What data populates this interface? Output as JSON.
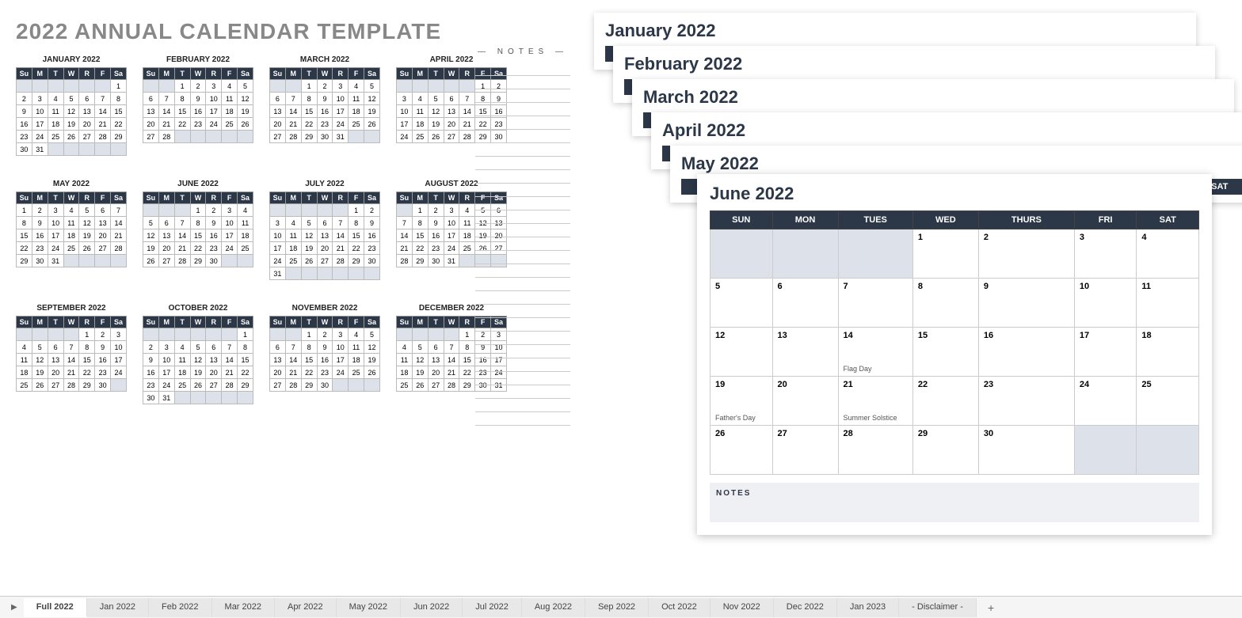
{
  "title": "2022 ANNUAL CALENDAR TEMPLATE",
  "days_short": [
    "Su",
    "M",
    "T",
    "W",
    "R",
    "F",
    "Sa"
  ],
  "days_long": [
    "SUN",
    "MON",
    "TUES",
    "WED",
    "THURS",
    "FRI",
    "SAT"
  ],
  "notes_label": "NOTES",
  "minical_months": [
    {
      "name": "JANUARY 2022",
      "start": 6,
      "days": 31
    },
    {
      "name": "FEBRUARY 2022",
      "start": 2,
      "days": 28
    },
    {
      "name": "MARCH 2022",
      "start": 2,
      "days": 31
    },
    {
      "name": "APRIL 2022",
      "start": 5,
      "days": 30
    },
    {
      "name": "MAY 2022",
      "start": 0,
      "days": 31
    },
    {
      "name": "JUNE 2022",
      "start": 3,
      "days": 30
    },
    {
      "name": "JULY 2022",
      "start": 5,
      "days": 31
    },
    {
      "name": "AUGUST 2022",
      "start": 1,
      "days": 31
    },
    {
      "name": "SEPTEMBER 2022",
      "start": 4,
      "days": 30
    },
    {
      "name": "OCTOBER 2022",
      "start": 6,
      "days": 31
    },
    {
      "name": "NOVEMBER 2022",
      "start": 2,
      "days": 30
    },
    {
      "name": "DECEMBER 2022",
      "start": 4,
      "days": 31
    }
  ],
  "stack_headers": [
    "January 2022",
    "February 2022",
    "March 2022",
    "April 2022",
    "May 2022"
  ],
  "big_month": {
    "title": "June 2022",
    "start": 3,
    "days": 30,
    "events": {
      "14": "Flag Day",
      "19": "Father's Day",
      "21": "Summer Solstice"
    },
    "notes_label": "NOTES"
  },
  "tabs": [
    "Full 2022",
    "Jan 2022",
    "Feb 2022",
    "Mar 2022",
    "Apr 2022",
    "May 2022",
    "Jun 2022",
    "Jul 2022",
    "Aug 2022",
    "Sep 2022",
    "Oct 2022",
    "Nov 2022",
    "Dec 2022",
    "Jan 2023",
    "- Disclaimer -"
  ],
  "active_tab": 0
}
